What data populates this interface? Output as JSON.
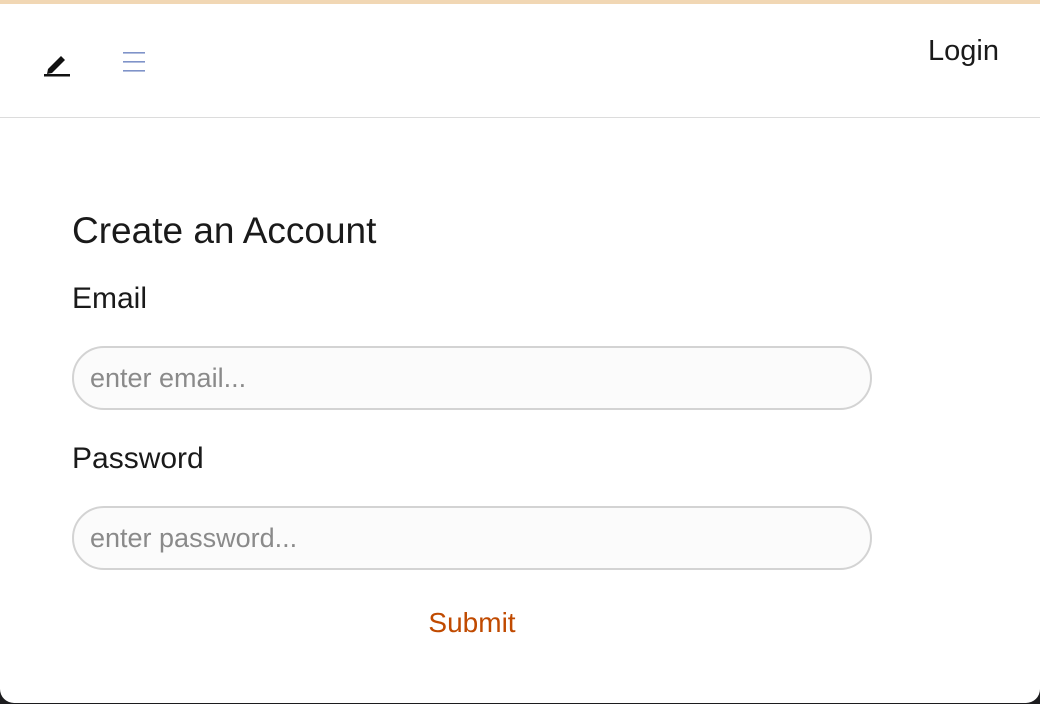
{
  "navbar": {
    "brand_icon": "pencil-icon",
    "menu_icon": "hamburger-menu-icon",
    "login_label": "Login",
    "menu_icon_color": "#7f93c9"
  },
  "form": {
    "title": "Create an Account",
    "email_label": "Email",
    "email_placeholder": "enter email...",
    "email_value": "",
    "password_label": "Password",
    "password_placeholder": "enter password...",
    "password_value": "",
    "submit_label": "Submit"
  },
  "colors": {
    "accent": "#c04a00",
    "window_top_border": "#f1d7b4"
  }
}
